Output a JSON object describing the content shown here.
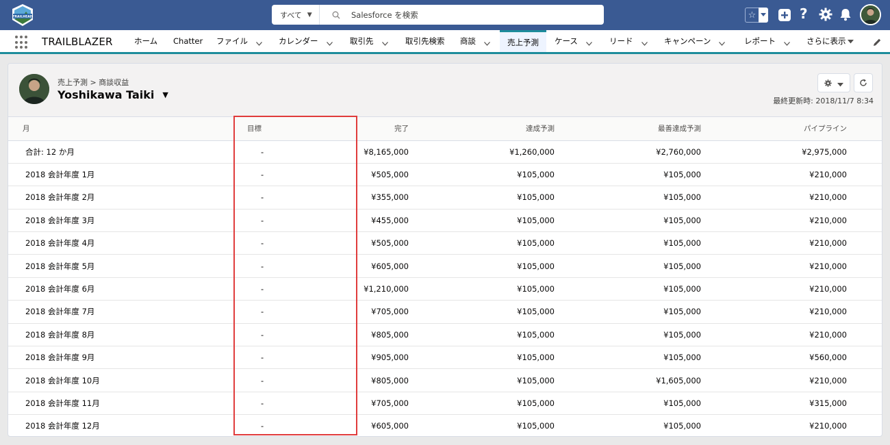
{
  "colors": {
    "header_bg": "#3a5a93",
    "accent": "#1c8c9b",
    "highlight": "#e03b3b"
  },
  "header": {
    "logo_text": "TRAILHEAD",
    "search": {
      "scope": "すべて",
      "placeholder": "Salesforce を検索"
    },
    "icons": [
      "favorites-star-icon",
      "add-icon",
      "help-icon",
      "gear-icon",
      "bell-icon",
      "user-avatar"
    ]
  },
  "nav": {
    "app_name": "TRAILBLAZER",
    "items": [
      {
        "label": "ホーム",
        "dropdown": false
      },
      {
        "label": "Chatter",
        "dropdown": false
      },
      {
        "label": "ファイル",
        "dropdown": true
      },
      {
        "label": "カレンダー",
        "dropdown": true
      },
      {
        "label": "取引先",
        "dropdown": true
      },
      {
        "label": "取引先検索",
        "dropdown": false
      },
      {
        "label": "商談",
        "dropdown": true
      },
      {
        "label": "売上予測",
        "dropdown": false,
        "active": true
      },
      {
        "label": "ケース",
        "dropdown": true
      },
      {
        "label": "リード",
        "dropdown": true
      },
      {
        "label": "キャンペーン",
        "dropdown": true
      },
      {
        "label": "レポート",
        "dropdown": true
      },
      {
        "label": "さらに表示",
        "dropdown": true
      }
    ]
  },
  "forecast": {
    "breadcrumb": "売上予測 > 商談収益",
    "owner": "Yoshikawa Taiki",
    "last_updated": "最終更新時: 2018/11/7 8:34",
    "columns": [
      "月",
      "目標",
      "完了",
      "達成予測",
      "最善達成予測",
      "パイプライン"
    ],
    "rows": [
      [
        "合計: 12 か月",
        "-",
        "¥8,165,000",
        "¥1,260,000",
        "¥2,760,000",
        "¥2,975,000"
      ],
      [
        "2018 会計年度 1月",
        "-",
        "¥505,000",
        "¥105,000",
        "¥105,000",
        "¥210,000"
      ],
      [
        "2018 会計年度 2月",
        "-",
        "¥355,000",
        "¥105,000",
        "¥105,000",
        "¥210,000"
      ],
      [
        "2018 会計年度 3月",
        "-",
        "¥455,000",
        "¥105,000",
        "¥105,000",
        "¥210,000"
      ],
      [
        "2018 会計年度 4月",
        "-",
        "¥505,000",
        "¥105,000",
        "¥105,000",
        "¥210,000"
      ],
      [
        "2018 会計年度 5月",
        "-",
        "¥605,000",
        "¥105,000",
        "¥105,000",
        "¥210,000"
      ],
      [
        "2018 会計年度 6月",
        "-",
        "¥1,210,000",
        "¥105,000",
        "¥105,000",
        "¥210,000"
      ],
      [
        "2018 会計年度 7月",
        "-",
        "¥705,000",
        "¥105,000",
        "¥105,000",
        "¥210,000"
      ],
      [
        "2018 会計年度 8月",
        "-",
        "¥805,000",
        "¥105,000",
        "¥105,000",
        "¥210,000"
      ],
      [
        "2018 会計年度 9月",
        "-",
        "¥905,000",
        "¥105,000",
        "¥105,000",
        "¥560,000"
      ],
      [
        "2018 会計年度 10月",
        "-",
        "¥805,000",
        "¥105,000",
        "¥1,605,000",
        "¥210,000"
      ],
      [
        "2018 会計年度 11月",
        "-",
        "¥705,000",
        "¥105,000",
        "¥105,000",
        "¥315,000"
      ],
      [
        "2018 会計年度 12月",
        "-",
        "¥605,000",
        "¥105,000",
        "¥105,000",
        "¥210,000"
      ]
    ]
  }
}
